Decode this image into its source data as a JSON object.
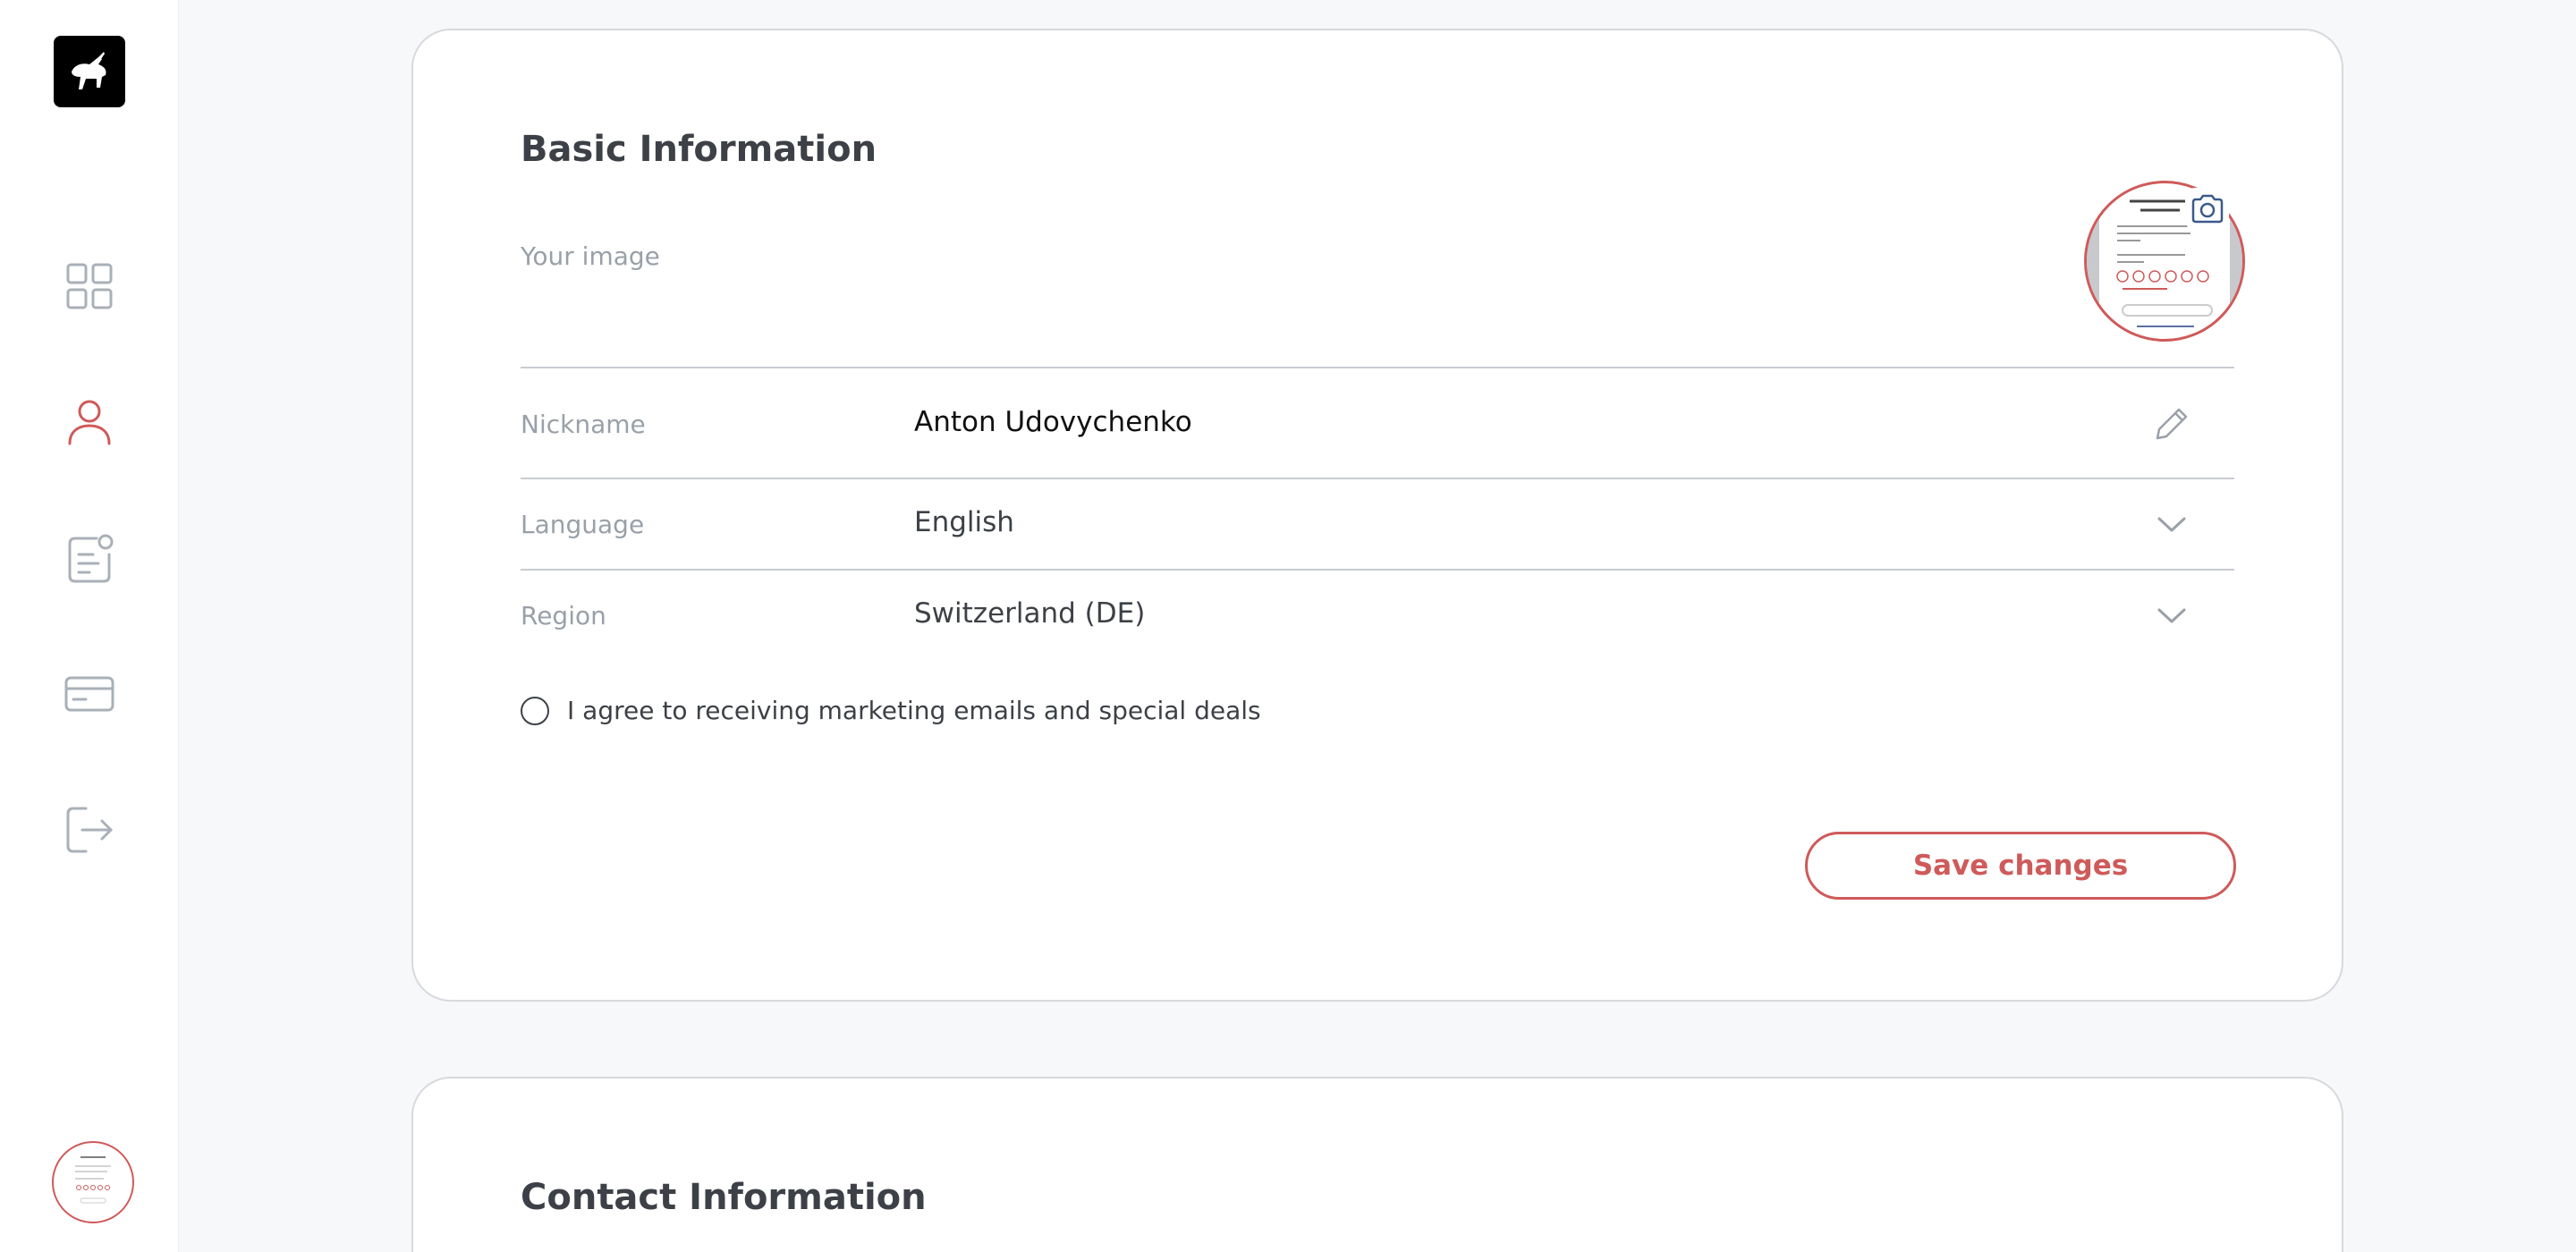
{
  "sidebar": {
    "logo": "bull-logo",
    "items": [
      {
        "name": "dashboard",
        "icon": "grid-icon",
        "active": false
      },
      {
        "name": "profile",
        "icon": "user-icon",
        "active": true
      },
      {
        "name": "documents",
        "icon": "document-icon",
        "active": false
      },
      {
        "name": "payments",
        "icon": "card-icon",
        "active": false
      },
      {
        "name": "logout",
        "icon": "logout-icon",
        "active": false
      }
    ]
  },
  "basic_info": {
    "title": "Basic Information",
    "your_image_label": "Your image",
    "nickname": {
      "label": "Nickname",
      "value": "Anton Udovychenko"
    },
    "language": {
      "label": "Language",
      "value": "English"
    },
    "region": {
      "label": "Region",
      "value": "Switzerland (DE)"
    },
    "marketing_consent": {
      "label": "I agree to receiving marketing emails and special deals",
      "checked": false
    },
    "save_label": "Save changes"
  },
  "contact_info": {
    "title": "Contact Information"
  },
  "colors": {
    "accent": "#cf5a5a",
    "icon_gray": "#aab0b8",
    "text": "#3d4147",
    "muted": "#9aa0a8",
    "background": "#f7f8fa"
  }
}
